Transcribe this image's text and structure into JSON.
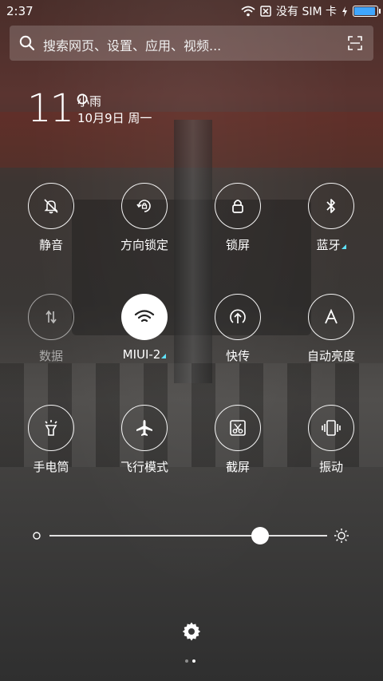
{
  "status_bar": {
    "time": "2:37",
    "sim_text": "没有 SIM 卡",
    "battery_level": 1.0,
    "battery_color": "#3fa6ff"
  },
  "search": {
    "placeholder": "搜索网页、设置、应用、视频...",
    "icons": [
      "search-icon",
      "scan-icon"
    ]
  },
  "weather": {
    "temperature": "11°",
    "condition": "小雨",
    "date": "10月9日 周一"
  },
  "quick_tiles": [
    {
      "label": "静音",
      "icon": "mute-bell-icon",
      "active": false,
      "has_submenu": false
    },
    {
      "label": "方向锁定",
      "icon": "rotation-lock-icon",
      "active": false,
      "has_submenu": false
    },
    {
      "label": "锁屏",
      "icon": "lock-icon",
      "active": false,
      "has_submenu": false
    },
    {
      "label": "蓝牙",
      "icon": "bluetooth-icon",
      "active": false,
      "has_submenu": true
    },
    {
      "label": "数据",
      "icon": "data-arrows-icon",
      "active": false,
      "has_submenu": false
    },
    {
      "label": "MIUI-2",
      "icon": "wifi-icon",
      "active": true,
      "has_submenu": true
    },
    {
      "label": "快传",
      "icon": "quick-transfer-icon",
      "active": false,
      "has_submenu": false
    },
    {
      "label": "自动亮度",
      "icon": "auto-brightness-icon",
      "active": false,
      "has_submenu": false
    },
    {
      "label": "手电筒",
      "icon": "flashlight-icon",
      "active": false,
      "has_submenu": false
    },
    {
      "label": "飞行模式",
      "icon": "airplane-icon",
      "active": false,
      "has_submenu": false
    },
    {
      "label": "截屏",
      "icon": "screenshot-scissors-icon",
      "active": false,
      "has_submenu": false
    },
    {
      "label": "振动",
      "icon": "vibrate-icon",
      "active": false,
      "has_submenu": false
    }
  ],
  "brightness": {
    "level": 0.76
  },
  "footer": {
    "settings_icon": "gear-icon",
    "page_count": 2,
    "current_page": 2
  }
}
